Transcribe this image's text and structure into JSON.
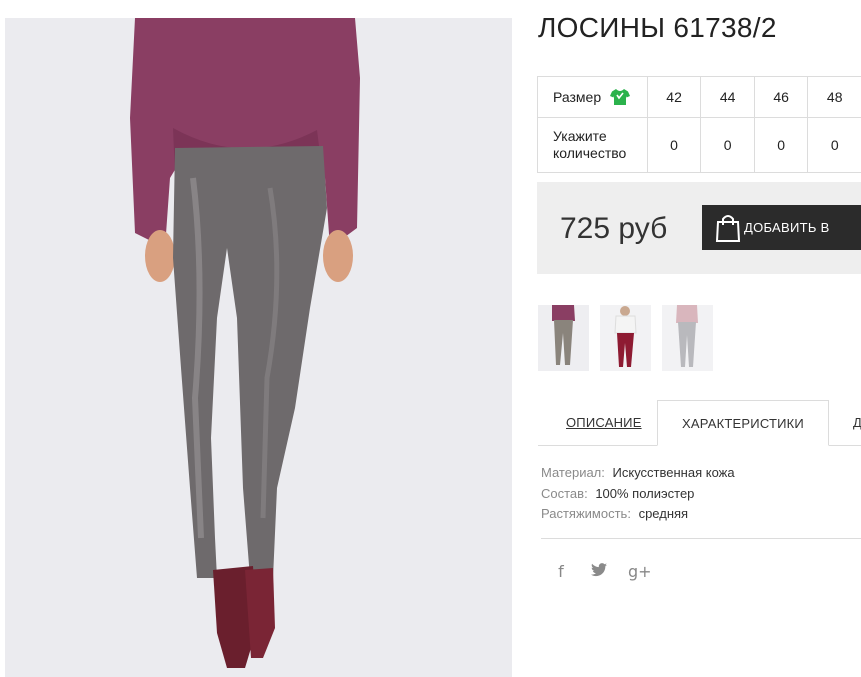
{
  "product": {
    "title": "ЛОСИНЫ 61738/2"
  },
  "size_table": {
    "size_label": "Размер",
    "size_icon": "t-shirt-icon",
    "qty_label_line1": "Укажите",
    "qty_label_line2": "количество",
    "sizes": [
      "42",
      "44",
      "46",
      "48"
    ],
    "quantities": [
      "0",
      "0",
      "0",
      "0"
    ]
  },
  "purchase": {
    "price": "725 руб",
    "add_button_label": "ДОБАВИТЬ В",
    "button_icon": "shopping-bag-icon"
  },
  "tabs": {
    "description": "ОПИСАНИЕ",
    "characteristics": "ХАРАКТЕРИСТИКИ",
    "third": "Д"
  },
  "specs": [
    {
      "key": "Материал:",
      "value": "Искусственная кожа"
    },
    {
      "key": "Состав:",
      "value": "100% полиэстер"
    },
    {
      "key": "Растяжимость:",
      "value": "средняя"
    }
  ],
  "social": {
    "facebook": "f",
    "twitter": "twitter-bird",
    "google_plus": "g+"
  },
  "colors": {
    "accent_green": "#2bb24c",
    "button_bg": "#2b2b2b",
    "price_box_bg": "#eeeeee"
  }
}
